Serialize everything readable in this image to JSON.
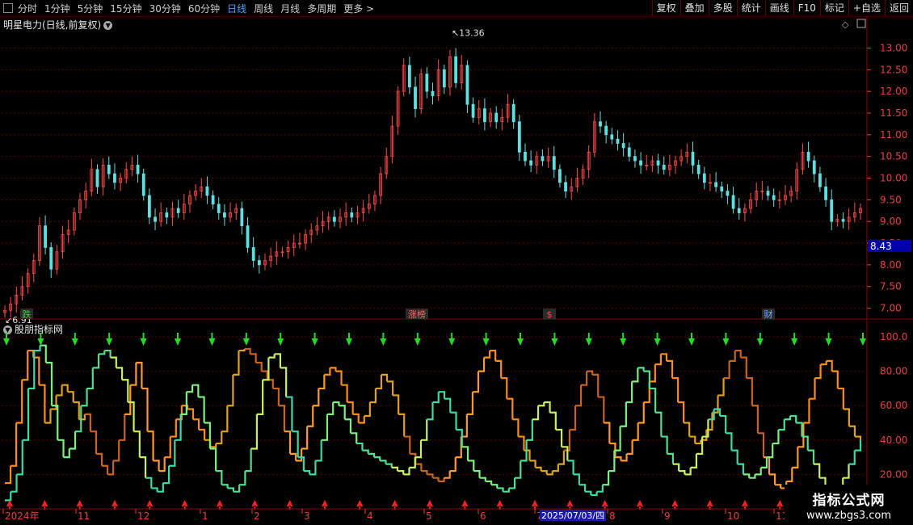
{
  "toolbar": {
    "periods": [
      "分时",
      "1分钟",
      "5分钟",
      "15分钟",
      "30分钟",
      "60分钟",
      "日线",
      "周线",
      "月线",
      "多周期",
      "更多 >"
    ],
    "active_period": "日线",
    "right_buttons": [
      "复权",
      "叠加",
      "多股",
      "统计",
      "画线",
      "F10",
      "标记",
      "+自选",
      "返回"
    ]
  },
  "main_panel": {
    "title": "明星电力(日线,前复权)",
    "high_marker": "13.36",
    "low_marker": "6.91",
    "current_price": "8.43",
    "event_tags": [
      {
        "label": "跌",
        "color": "#44cc44"
      },
      {
        "label": "涨榜",
        "color": "#ff6666"
      },
      {
        "label": "$",
        "color": "#ff4444"
      },
      {
        "label": "财",
        "color": "#66aaff"
      }
    ],
    "price_ticks": [
      "13.00",
      "12.50",
      "12.00",
      "11.50",
      "11.00",
      "10.50",
      "10.00",
      "9.50",
      "9.00",
      "8.50",
      "8.00",
      "7.50",
      "7.00"
    ]
  },
  "indicator_panel": {
    "title": "股朋指标网",
    "ticks": [
      "100.0",
      "80.00",
      "60.00",
      "40.00",
      "20.00"
    ]
  },
  "time_axis": {
    "labels": [
      "2024年",
      "11",
      "12",
      "1",
      "2",
      "3",
      "4",
      "5",
      "6",
      "7",
      "8",
      "9",
      "10",
      "11"
    ],
    "cursor_date": "2025/07/03/四"
  },
  "watermark": {
    "line1": "指标公式网",
    "line2": "www.zbgs3.com"
  },
  "colors": {
    "up": "#ff4a4a",
    "down": "#5fe0e0",
    "grid": "#5a0000",
    "axis": "#e84040",
    "signal_buy": "#ff2020",
    "signal_sell": "#22dd22"
  },
  "chart_data": {
    "type": "candlestick",
    "price_range": [
      6.75,
      13.4
    ],
    "indicator_range": [
      0,
      108
    ],
    "close_series": [
      6.95,
      7.1,
      7.3,
      7.5,
      7.8,
      8.1,
      8.9,
      8.4,
      7.9,
      8.3,
      8.7,
      8.8,
      9.2,
      9.5,
      9.7,
      10.2,
      9.8,
      10.3,
      10.1,
      9.9,
      10.0,
      10.2,
      10.3,
      10.1,
      9.6,
      9.1,
      9.0,
      9.2,
      9.1,
      9.3,
      9.2,
      9.4,
      9.6,
      9.7,
      9.8,
      9.6,
      9.4,
      9.2,
      9.1,
      9.2,
      9.3,
      8.9,
      8.4,
      8.1,
      8.0,
      8.1,
      8.2,
      8.3,
      8.3,
      8.4,
      8.5,
      8.5,
      8.7,
      8.8,
      8.9,
      9.0,
      9.1,
      9.0,
      9.1,
      9.2,
      9.1,
      9.2,
      9.3,
      9.4,
      9.6,
      10.1,
      10.5,
      11.2,
      12.0,
      12.6,
      12.1,
      11.6,
      12.4,
      12.0,
      11.9,
      12.5,
      12.1,
      12.8,
      12.2,
      12.6,
      11.7,
      11.4,
      11.6,
      11.3,
      11.5,
      11.3,
      11.4,
      11.7,
      11.3,
      10.6,
      10.4,
      10.3,
      10.5,
      10.4,
      10.5,
      10.2,
      9.9,
      9.7,
      9.8,
      10.0,
      10.2,
      10.6,
      11.3,
      11.2,
      11.0,
      10.9,
      10.8,
      10.7,
      10.5,
      10.4,
      10.3,
      10.3,
      10.4,
      10.3,
      10.2,
      10.3,
      10.4,
      10.5,
      10.6,
      10.3,
      10.1,
      9.9,
      9.9,
      9.8,
      9.7,
      9.6,
      9.3,
      9.2,
      9.3,
      9.5,
      9.7,
      9.7,
      9.6,
      9.5,
      9.5,
      9.6,
      9.7,
      10.2,
      10.6,
      10.4,
      10.1,
      9.8,
      9.5,
      9.0,
      9.05,
      9.0,
      9.1,
      9.2,
      9.3
    ],
    "indicator_series": [
      {
        "name": "",
        "values": [
          15,
          25,
          50,
          75,
          92,
          88,
          72,
          50,
          58,
          66,
          72,
          68,
          62,
          52,
          55,
          45,
          32,
          25,
          20,
          28,
          40,
          55,
          72,
          85,
          70,
          45,
          28,
          22,
          30,
          42,
          52,
          60,
          58,
          52,
          46,
          40,
          36,
          38,
          45,
          60,
          78,
          92,
          93,
          90,
          85,
          80,
          75,
          70,
          60,
          45,
          32,
          28,
          35,
          48,
          60,
          70,
          78,
          82,
          80,
          72,
          62,
          55,
          50,
          54,
          62,
          70,
          78,
          74,
          66,
          55,
          42,
          32,
          26,
          22,
          20,
          18,
          16,
          18,
          22,
          30,
          42,
          55,
          68,
          80,
          88,
          92,
          86,
          76,
          64,
          52,
          42,
          34,
          28,
          24,
          22,
          20,
          22,
          26,
          34,
          46,
          60,
          72,
          80,
          78,
          65,
          50,
          38,
          30,
          28,
          32,
          40,
          50,
          62,
          74,
          84,
          90,
          86,
          76,
          62,
          50,
          42,
          38,
          40,
          46,
          56,
          66,
          76,
          86,
          92,
          88,
          76,
          60,
          44,
          30,
          20,
          14,
          12,
          16,
          24,
          36,
          50,
          64,
          76,
          84,
          86,
          80,
          70,
          58,
          48,
          42,
          40
        ]
      },
      {
        "name": "",
        "values": [
          5,
          10,
          20,
          40,
          70,
          92,
          95,
          85,
          60,
          40,
          30,
          35,
          45,
          60,
          70,
          82,
          90,
          92,
          88,
          82,
          75,
          62,
          45,
          30,
          18,
          12,
          10,
          15,
          25,
          40,
          55,
          68,
          72,
          65,
          50,
          35,
          22,
          14,
          12,
          10,
          14,
          22,
          35,
          55,
          75,
          88,
          90,
          82,
          65,
          45,
          30,
          22,
          20,
          28,
          40,
          55,
          62,
          60,
          52,
          44,
          38,
          34,
          32,
          30,
          28,
          26,
          24,
          22,
          20,
          24,
          30,
          40,
          52,
          62,
          68,
          64,
          56,
          46,
          36,
          28,
          22,
          18,
          16,
          14,
          12,
          10,
          12,
          18,
          28,
          40,
          52,
          60,
          62,
          56,
          46,
          36,
          28,
          20,
          14,
          10,
          8,
          10,
          14,
          22,
          34,
          48,
          62,
          74,
          82,
          80,
          70,
          56,
          42,
          32,
          26,
          22,
          20,
          24,
          32,
          42,
          52,
          58,
          54,
          44,
          34,
          26,
          20,
          18,
          20,
          24,
          30,
          38,
          46,
          52,
          54,
          50,
          42,
          34,
          26,
          18,
          12,
          10,
          12,
          18,
          26,
          34,
          40
        ]
      }
    ],
    "sell_signals": 26,
    "buy_signals": 25
  }
}
